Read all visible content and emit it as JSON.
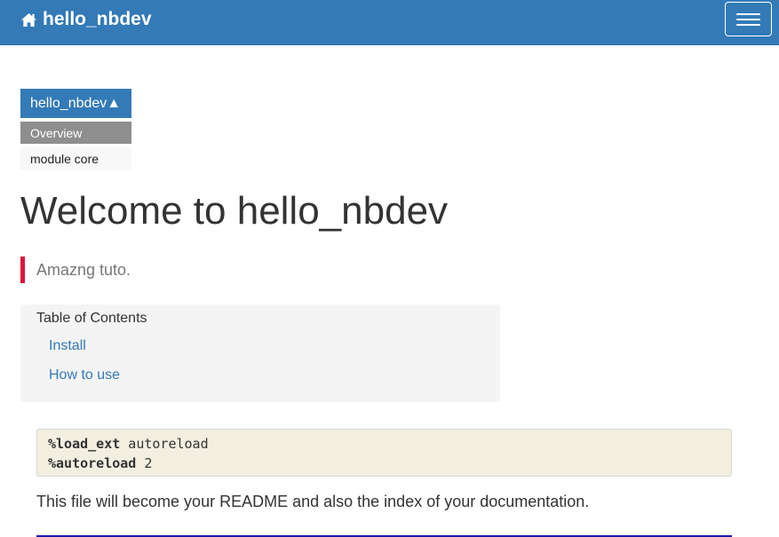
{
  "navbar": {
    "brand": "hello_nbdev",
    "brand_icon": "home-icon",
    "menu_icon": "hamburger-menu-icon",
    "color": "#337ab7"
  },
  "sidebar": {
    "toggle_label": "hello_nbdev▲",
    "items": [
      {
        "label": "Overview",
        "active": true
      },
      {
        "label": "module core",
        "active": false
      }
    ]
  },
  "main": {
    "title": "Welcome to hello_nbdev",
    "summary": "Amazng tuto.",
    "summary_accent": "#dc143c",
    "toc": {
      "title": "Table of Contents",
      "links": [
        "Install",
        "How to use"
      ]
    },
    "code_cell": {
      "lines": [
        {
          "keyword": "%load_ext",
          "rest": " autoreload"
        },
        {
          "keyword": "%autoreload",
          "rest": " 2"
        }
      ]
    },
    "paragraph": "This file will become your README and also the index of your documentation."
  }
}
